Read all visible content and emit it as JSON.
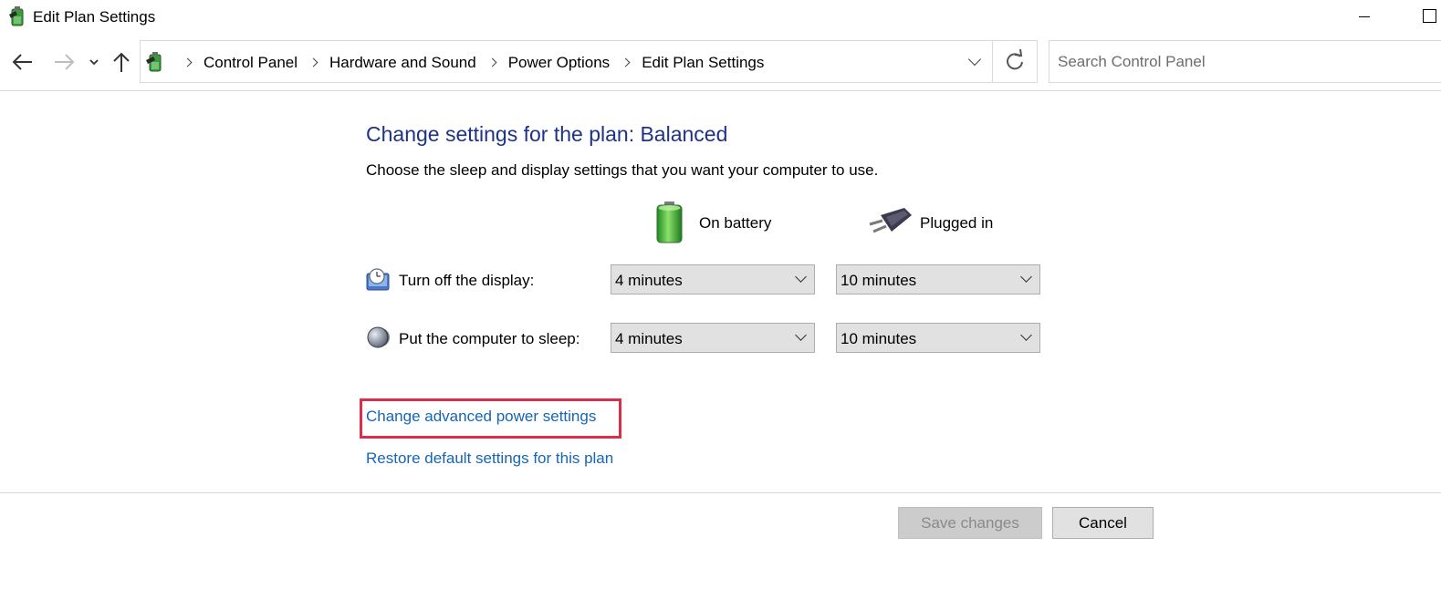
{
  "window": {
    "title": "Edit Plan Settings"
  },
  "navigation": {
    "breadcrumbs": [
      "Control Panel",
      "Hardware and Sound",
      "Power Options",
      "Edit Plan Settings"
    ],
    "search_placeholder": "Search Control Panel"
  },
  "main": {
    "heading": "Change settings for the plan: Balanced",
    "subheading": "Choose the sleep and display settings that you want your computer to use.",
    "columns": {
      "battery": "On battery",
      "plugged": "Plugged in"
    },
    "rows": [
      {
        "label": "Turn off the display:",
        "battery_value": "4 minutes",
        "plugged_value": "10 minutes"
      },
      {
        "label": "Put the computer to sleep:",
        "battery_value": "4 minutes",
        "plugged_value": "10 minutes"
      }
    ],
    "links": {
      "advanced": "Change advanced power settings",
      "restore": "Restore default settings for this plan"
    }
  },
  "footer": {
    "save_label": "Save changes",
    "cancel_label": "Cancel"
  },
  "colors": {
    "heading": "#1e3287",
    "link": "#1765b5",
    "highlight": "#dc2e4a"
  }
}
